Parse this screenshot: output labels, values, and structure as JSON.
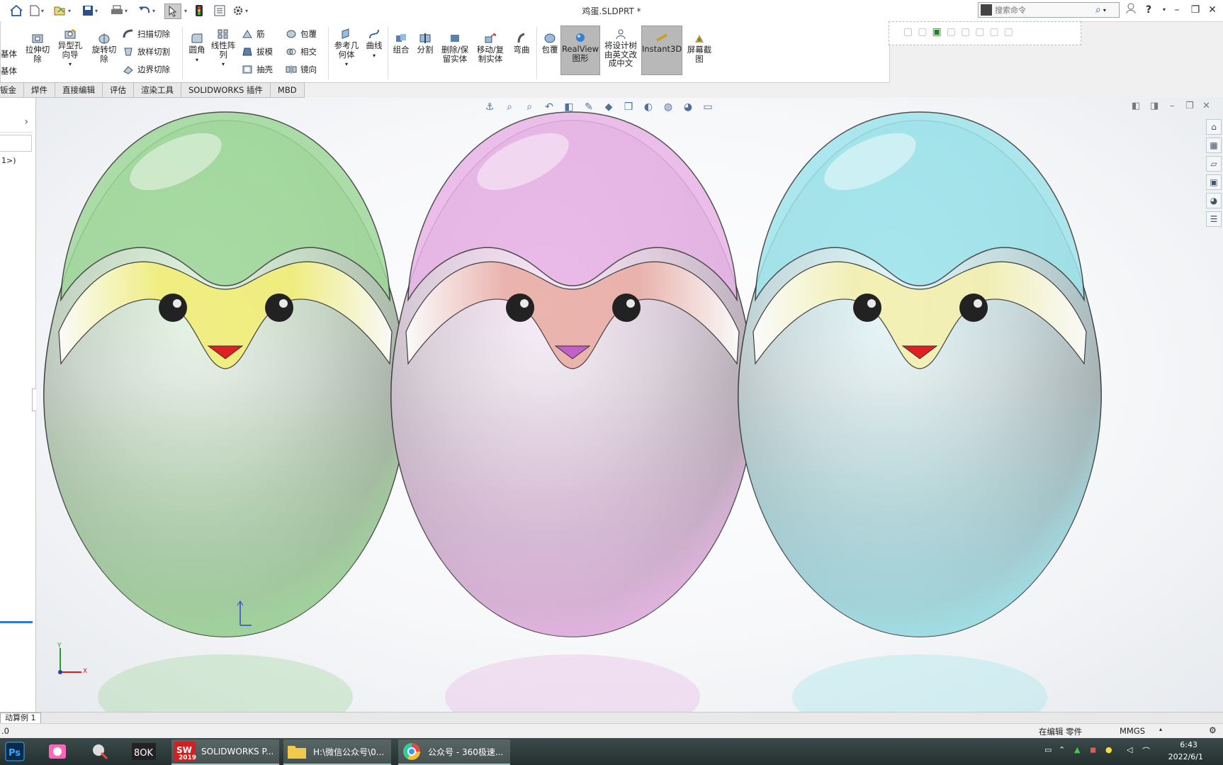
{
  "title_bar": {
    "document_title": "鸡蛋.SLDPRT *",
    "search_placeholder": "搜索命令",
    "help_label": "?"
  },
  "ribbon": {
    "left_cut_labels": [
      "基体",
      "基体"
    ],
    "buttons": {
      "extrude_cut": "拉伸切除",
      "hole_wizard": "异型孔向导",
      "revolve_cut": "旋转切除",
      "swept_cut": "扫描切除",
      "lofted_cut": "放样切割",
      "boundary_cut": "边界切除",
      "fillet": "圆角",
      "linear_pattern": "线性阵列",
      "rib": "筋",
      "draft": "拔模",
      "shell": "抽壳",
      "wrap": "包覆",
      "intersect": "相交",
      "mirror": "镜向",
      "ref_geometry": "参考几何体",
      "curves": "曲线",
      "combine": "组合",
      "split": "分割",
      "delete_keep_body": "删除/保留实体",
      "move_copy_body": "移动/复制实体",
      "flex": "弯曲",
      "wrap2": "包覆",
      "realview": "RealView图形",
      "translate_tree": "将设计树由英文改成中文",
      "instant3d": "Instant3D",
      "screen_capture": "屏幕截图"
    }
  },
  "tabs": [
    "钣金",
    "焊件",
    "直接编辑",
    "评估",
    "渲染工具",
    "SOLIDWORKS 插件",
    "MBD"
  ],
  "left_panel": {
    "tree_item": "1>)"
  },
  "viewport": {
    "eggs": [
      {
        "name": "green",
        "shell": "#9fd89a",
        "band": "#f2ee7a",
        "beak": "#e02020"
      },
      {
        "name": "pink",
        "shell": "#e8b4e6",
        "band": "#eab0a8",
        "beak": "#c060c8"
      },
      {
        "name": "cyan",
        "shell": "#9fe4ec",
        "band": "#f4f0b0",
        "beak": "#e02020"
      }
    ],
    "triad_labels": {
      "x": "X",
      "y": "Y"
    }
  },
  "model_tab": "动算例 1",
  "status_bar": {
    "left_text": ".0",
    "editing": "在编辑 零件",
    "units": "MMGS"
  },
  "taskbar": {
    "apps": [
      {
        "label": "SOLIDWORKS P..."
      },
      {
        "label": "H:\\微信公众号\\0..."
      },
      {
        "label": "公众号 - 360极速..."
      }
    ],
    "sw_year": "2019",
    "time": "6:43",
    "date": "2022/6/1"
  }
}
